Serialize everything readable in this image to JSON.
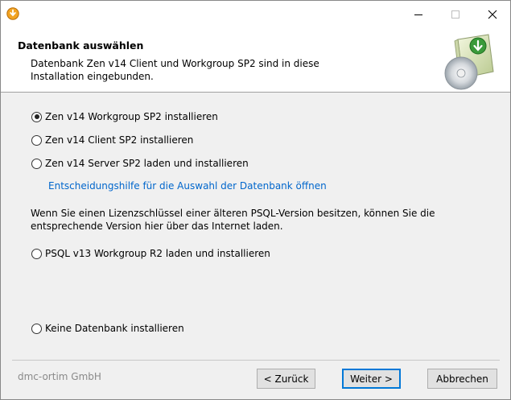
{
  "titlebar": {
    "icons": [
      "app-setup-icon",
      "minimize-icon",
      "maximize-icon",
      "close-icon"
    ]
  },
  "header": {
    "title": "Datenbank auswählen",
    "description": "Datenbank Zen v14 Client und Workgroup SP2 sind in diese Installation eingebunden.",
    "graphic": "database-install-icon"
  },
  "options": {
    "workgroup": "Zen v14 Workgroup SP2 installieren",
    "client": "Zen v14 Client SP2 installieren",
    "server": "Zen v14 Server SP2 laden und installieren",
    "help_link": "Entscheidungshilfe für die Auswahl der Datenbank öffnen",
    "info_text": "Wenn Sie einen Lizenzschlüssel einer älteren PSQL-Version besitzen, können Sie die entsprechende Version hier über das Internet laden.",
    "psql": "PSQL v13 Workgroup R2 laden und installieren",
    "none": "Keine Datenbank installieren",
    "selected": "workgroup"
  },
  "footer": {
    "company": "dmc-ortim GmbH",
    "back_label": "< Zurück",
    "next_label": "Weiter >",
    "cancel_label": "Abbrechen"
  },
  "colors": {
    "link": "#0066cc",
    "accent_border": "#0078d7",
    "icon_orange": "#f2a321"
  }
}
